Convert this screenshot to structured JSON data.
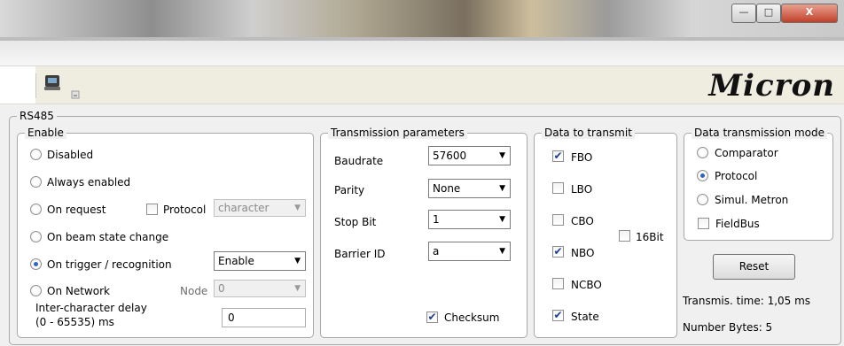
{
  "window": {
    "min_label": "—",
    "max_label": "□",
    "close_label": "X"
  },
  "toolbar": {
    "logo_text": "Micron"
  },
  "rs485": {
    "legend": "RS485"
  },
  "enable": {
    "legend": "Enable",
    "options": [
      {
        "label": "Disabled",
        "selected": false
      },
      {
        "label": "Always enabled",
        "selected": false
      },
      {
        "label": "On request",
        "selected": false
      },
      {
        "label": "On beam state change",
        "selected": false
      },
      {
        "label": "On trigger / recognition",
        "selected": true
      },
      {
        "label": "On Network",
        "selected": false
      }
    ],
    "protocol_label": "Protocol",
    "protocol_select": "character",
    "trigger_select": "Enable",
    "node_label": "Node",
    "node_select": "0",
    "delay_label_1": "Inter-character delay",
    "delay_label_2": "(0 - 65535) ms",
    "delay_value": "0"
  },
  "transmission": {
    "legend": "Transmission parameters",
    "baudrate_label": "Baudrate",
    "baudrate_value": "57600",
    "parity_label": "Parity",
    "parity_value": "None",
    "stopbit_label": "Stop Bit",
    "stopbit_value": "1",
    "barrier_label": "Barrier ID",
    "barrier_value": "a",
    "checksum_label": "Checksum",
    "checksum_checked": true
  },
  "data_to_transmit": {
    "legend": "Data to transmit",
    "items": [
      {
        "label": "FBO",
        "checked": true
      },
      {
        "label": "LBO",
        "checked": false
      },
      {
        "label": "CBO",
        "checked": false
      },
      {
        "label": "NBO",
        "checked": true
      },
      {
        "label": "NCBO",
        "checked": false
      },
      {
        "label": "State",
        "checked": true
      }
    ],
    "bit16_label": "16Bit",
    "bit16_checked": false
  },
  "mode": {
    "legend": "Data transmission mode",
    "options": [
      {
        "label": "Comparator",
        "selected": false
      },
      {
        "label": "Protocol",
        "selected": true
      },
      {
        "label": "Simul. Metron",
        "selected": false
      }
    ],
    "fieldbus_label": "FieldBus",
    "fieldbus_checked": false,
    "reset_label": "Reset",
    "transmis_time": "Transmis. time: 1,05 ms",
    "number_bytes": "Number Bytes: 5"
  },
  "check_glyph": "✔"
}
